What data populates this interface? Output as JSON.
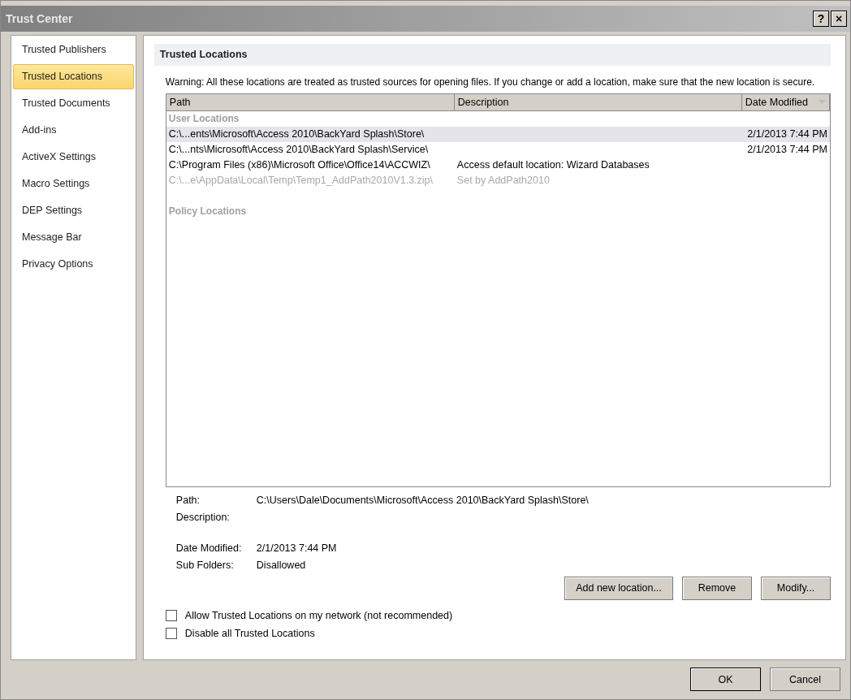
{
  "window": {
    "title": "Trust Center",
    "title_buttons": [
      "?",
      "×"
    ]
  },
  "sidebar": {
    "items": [
      {
        "label": "Trusted Publishers",
        "selected": false
      },
      {
        "label": "Trusted Locations",
        "selected": true
      },
      {
        "label": "Trusted Documents",
        "selected": false
      },
      {
        "label": "Add-ins",
        "selected": false
      },
      {
        "label": "ActiveX Settings",
        "selected": false
      },
      {
        "label": "Macro Settings",
        "selected": false
      },
      {
        "label": "DEP Settings",
        "selected": false
      },
      {
        "label": "Message Bar",
        "selected": false
      },
      {
        "label": "Privacy Options",
        "selected": false
      }
    ]
  },
  "section_title": "Trusted Locations",
  "warning": "Warning: All these locations are treated as trusted sources for opening files.  If you change or add a location, make sure that the new location is secure.",
  "table": {
    "columns": [
      "Path",
      "Description",
      "Date Modified"
    ],
    "rows": [
      {
        "kind": "group",
        "label": "User Locations"
      },
      {
        "kind": "item",
        "path": "C:\\...ents\\Microsoft\\Access 2010\\BackYard Splash\\Store\\",
        "date": "2/1/2013 7:44 PM",
        "selected": true,
        "disabled": false
      },
      {
        "kind": "item",
        "path": "C:\\...nts\\Microsoft\\Access 2010\\BackYard Splash\\Service\\",
        "date": "2/1/2013 7:44 PM",
        "selected": false,
        "disabled": false
      },
      {
        "kind": "item",
        "path": "C:\\Program Files (x86)\\Microsoft Office\\Office14\\ACCWIZ\\",
        "description": "Access default location: Wizard Databases",
        "selected": false,
        "disabled": false
      },
      {
        "kind": "item",
        "path": "C:\\...e\\AppData\\Local\\Temp\\Temp1_AddPath2010V1.3.zip\\",
        "description": "Set by AddPath2010",
        "selected": false,
        "disabled": true
      },
      {
        "kind": "spacer"
      },
      {
        "kind": "group",
        "label": "Policy Locations"
      }
    ]
  },
  "details": [
    {
      "label": "Path:",
      "value": "C:\\Users\\Dale\\Documents\\Microsoft\\Access 2010\\BackYard Splash\\Store\\"
    },
    {
      "label": "Description:"
    },
    {
      "kind": "gap"
    },
    {
      "label": "Date Modified:",
      "value": "2/1/2013 7:44 PM"
    },
    {
      "label": "Sub Folders:",
      "value": "Disallowed"
    }
  ],
  "actions": [
    "Add new location...",
    "Remove",
    "Modify..."
  ],
  "options": [
    {
      "label": "Allow Trusted Locations on my network (not recommended)",
      "checked": false
    },
    {
      "label": "Disable all Trusted Locations",
      "checked": false
    }
  ],
  "footer_buttons": [
    "OK",
    "Cancel"
  ]
}
